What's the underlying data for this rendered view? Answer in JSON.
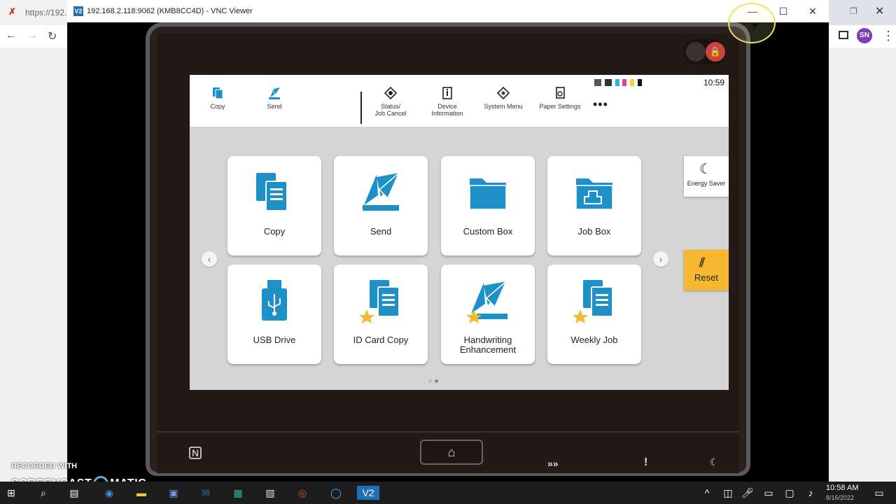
{
  "browser": {
    "url_fragment": "https://192.",
    "avatar_initials": "SN"
  },
  "vnc": {
    "title": "192.168.2.118:9062 (KMB8CC4D) - VNC Viewer",
    "minimize": "—",
    "maximize": "☐",
    "close": "✕"
  },
  "panel": {
    "clock": "10:59",
    "top_quick": [
      {
        "label": "Copy",
        "icon": "copy-icon"
      },
      {
        "label": "Send",
        "icon": "send-icon"
      }
    ],
    "top_menu": [
      {
        "label_1": "Status/",
        "label_2": "Job Cancel",
        "icon": "status-icon"
      },
      {
        "label_1": "Device",
        "label_2": "Information",
        "icon": "device-info-icon"
      },
      {
        "label_1": "System Menu",
        "label_2": "",
        "icon": "system-menu-icon"
      },
      {
        "label_1": "Paper Settings",
        "label_2": "",
        "icon": "paper-settings-icon"
      }
    ],
    "more": "•••",
    "tiles": [
      {
        "label_1": "Copy",
        "label_2": "",
        "icon": "copy-icon"
      },
      {
        "label_1": "Send",
        "label_2": "",
        "icon": "send-icon"
      },
      {
        "label_1": "Custom Box",
        "label_2": "",
        "icon": "folder-icon"
      },
      {
        "label_1": "Job Box",
        "label_2": "",
        "icon": "job-box-icon"
      },
      {
        "label_1": "USB Drive",
        "label_2": "",
        "icon": "usb-icon"
      },
      {
        "label_1": "ID Card Copy",
        "label_2": "",
        "icon": "id-card-copy-icon"
      },
      {
        "label_1": "Handwriting",
        "label_2": "Enhancement",
        "icon": "handwriting-icon"
      },
      {
        "label_1": "Weekly Job",
        "label_2": "",
        "icon": "weekly-job-icon"
      }
    ],
    "energy_saver": "Energy Saver",
    "reset": "Reset",
    "page_current": 1,
    "page_count": 2
  },
  "screencast": {
    "recorded_with": "RECORDED WITH",
    "brand_left": "SCREENCAST",
    "brand_right": "MATIC"
  },
  "taskbar": {
    "time": "10:58 AM",
    "date": "8/16/2022"
  },
  "colors": {
    "accent_blue": "#1e90c8",
    "reset_yellow": "#f5b82e",
    "star": "#f5b82e"
  }
}
